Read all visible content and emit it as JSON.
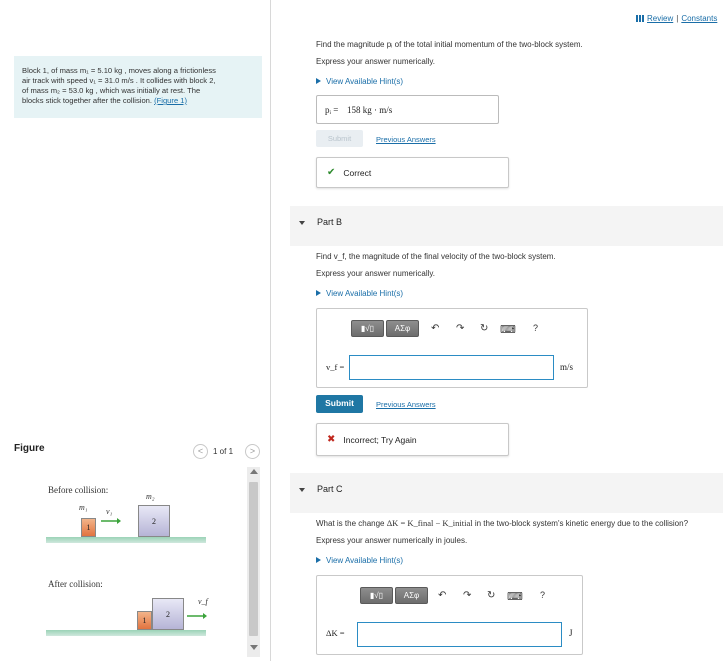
{
  "header": {
    "review_label": "Review",
    "separator": "|",
    "constants_label": "Constants"
  },
  "problem": {
    "line1": "Block 1, of mass m₁ = 5.10 kg , moves along a frictionless",
    "line2": "air track with speed v₁ = 31.0 m/s . It collides with block 2,",
    "line3": "of mass m₂ = 53.0 kg , which was initially at rest. The",
    "line4": "blocks stick together after the collision. ",
    "figure_link": "(Figure 1)"
  },
  "figure": {
    "label": "Figure",
    "counter": "1 of 1",
    "prev_glyph": "<",
    "next_glyph": ">",
    "before_title": "Before collision:",
    "after_title": "After collision:",
    "m1": "m₁",
    "m2": "m₂",
    "v1": "v₁",
    "vf": "v_f",
    "block1": "1",
    "block2": "2"
  },
  "part_a": {
    "question": "Find the magnitude pᵢ of the total initial momentum of the two-block system.",
    "instruction": "Express your answer numerically.",
    "hints_label": "View Available Hint(s)",
    "answer_label": "pᵢ =",
    "answer_value": "158  kg · m/s",
    "submit_label": "Submit",
    "previous_answers_label": "Previous Answers",
    "feedback_icon": "✔",
    "feedback_text": "Correct",
    "feedback_color": "#2e8b2e"
  },
  "part_b": {
    "title": "Part B",
    "question": "Find v_f, the magnitude of the final velocity of the two-block system.",
    "instruction": "Express your answer numerically.",
    "hints_label": "View Available Hint(s)",
    "toolbar": {
      "templates_label": "▮√▯",
      "symbols_label": "ΑΣφ",
      "undo_icon": "↶",
      "redo_icon": "↷",
      "reset_icon": "↻",
      "keyboard_icon": "⌨",
      "help_icon": "?"
    },
    "input_label": "v_f =",
    "input_value": "",
    "unit": "m/s",
    "submit_label": "Submit",
    "previous_answers_label": "Previous Answers",
    "feedback_icon": "✖",
    "feedback_text": "Incorrect; Try Again",
    "feedback_color": "#c0281e"
  },
  "part_c": {
    "title": "Part C",
    "question_prefix": "What is the change ",
    "question_math": "ΔK = K_final − K_initial",
    "question_suffix": " in the two-block system's kinetic energy due to the collision?",
    "instruction": "Express your answer numerically in joules.",
    "hints_label": "View Available Hint(s)",
    "toolbar": {
      "templates_label": "▮√▯",
      "symbols_label": "ΑΣφ",
      "undo_icon": "↶",
      "redo_icon": "↷",
      "reset_icon": "↻",
      "keyboard_icon": "⌨",
      "help_icon": "?"
    },
    "input_label": "ΔK =",
    "input_value": "",
    "unit": "J"
  },
  "colors": {
    "accent": "#1f77a4",
    "link": "#1a6ea8",
    "problem_bg": "#e6f3f5",
    "block1": "#e2733f",
    "block2": "#b6b4d6",
    "track": "#9bd3b7",
    "arrow": "#3aa33a"
  }
}
